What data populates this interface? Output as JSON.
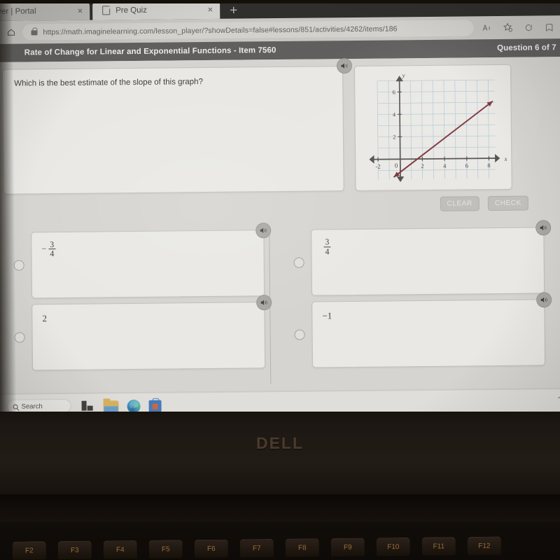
{
  "browser": {
    "tabs": [
      {
        "label": "ver | Portal",
        "active": false,
        "close": "×"
      },
      {
        "label": "Pre Quiz",
        "active": true,
        "close": "×"
      }
    ],
    "newtab_label": "+",
    "home_icon": "home-icon",
    "url": "https://math.imaginelearning.com/lesson_player/?showDetails=false#lessons/851/activities/4262/items/186",
    "toolbar_icons": [
      "read-aloud-icon",
      "favorites-icon",
      "browser-essentials-icon",
      "collections-icon"
    ]
  },
  "lesson": {
    "title": "Rate of Change for Linear and Exponential Functions - Item 7560",
    "progress": "Question 6 of 7"
  },
  "question": {
    "text": "Which is the best estimate of the slope of this graph?",
    "speaker_icon": "speaker-icon"
  },
  "actions": {
    "clear_label": "CLEAR",
    "check_label": "CHECK"
  },
  "choices": [
    {
      "display": "-3/4",
      "sign": "−",
      "numerator": "3",
      "denominator": "4",
      "kind": "fraction",
      "selected": false
    },
    {
      "display": "3/4",
      "sign": "",
      "numerator": "3",
      "denominator": "4",
      "kind": "fraction",
      "selected": false
    },
    {
      "display": "2",
      "kind": "plain",
      "value": "2",
      "selected": false
    },
    {
      "display": "-1",
      "kind": "plain",
      "value": "−1",
      "selected": false
    }
  ],
  "chart_data": {
    "type": "line",
    "title": "",
    "xlabel": "x",
    "ylabel": "y",
    "xlim": [
      -3,
      9
    ],
    "ylim": [
      -2,
      7.5
    ],
    "xticks": [
      -2,
      2,
      4,
      6,
      8
    ],
    "yticks": [
      2,
      4,
      6
    ],
    "origin_label": "0",
    "grid": true,
    "grid_color": "#9dc5dc",
    "axis_color": "#4a4a4a",
    "line_color": "#8e2230",
    "series": [
      {
        "name": "line",
        "x": [
          -0.6,
          8.4
        ],
        "y": [
          -1.6,
          5.1
        ],
        "slope": 0.75,
        "y_intercept": -1.15,
        "x_intercept": 1.5,
        "arrows": "both"
      }
    ]
  },
  "taskbar": {
    "search_label": "Search",
    "search_icon": "search-icon",
    "items": [
      "widgets-icon",
      "file-explorer-icon",
      "edge-icon",
      "microsoft-store-icon"
    ],
    "chevron": "⌃"
  },
  "laptop": {
    "brand": "DELL",
    "function_keys": [
      "F2",
      "F3",
      "F4",
      "F5",
      "F6",
      "F7",
      "F8",
      "F9",
      "F10",
      "F11",
      "F12"
    ]
  }
}
